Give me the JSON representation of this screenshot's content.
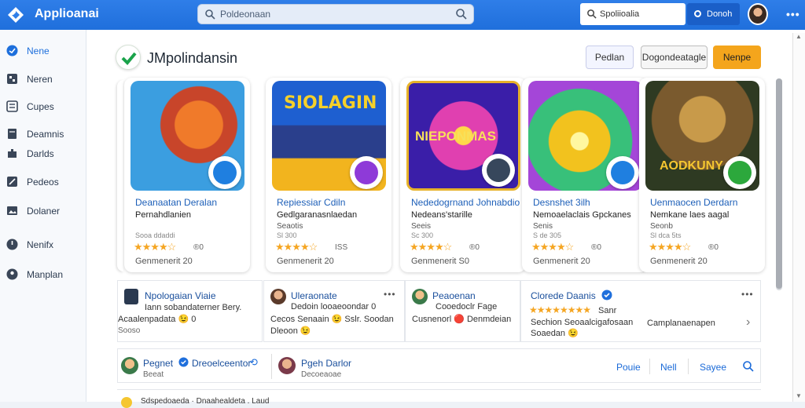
{
  "topbar": {
    "title": "Applioanai",
    "search_placeholder": "Poldeonaan",
    "search2_placeholder": "Spoliioalia",
    "button_label": "Donoh",
    "more": "•••"
  },
  "sidebar": {
    "items": [
      {
        "label": "Nene",
        "icon": "info-icon"
      },
      {
        "label": "Neren",
        "icon": "grid-icon"
      },
      {
        "label": "Cupes",
        "icon": "list-icon"
      },
      {
        "label": "Deamnis",
        "icon": "document-icon"
      },
      {
        "label": "Darlds",
        "icon": "puzzle-icon"
      },
      {
        "label": "Pedeos",
        "icon": "edit-icon"
      },
      {
        "label": "Dolaner",
        "icon": "image-icon"
      },
      {
        "label": "Nenifx",
        "icon": "power-icon"
      },
      {
        "label": "Manplan",
        "icon": "person-icon"
      }
    ]
  },
  "header": {
    "title": "JMpolindansin",
    "btn1": "Pedlan",
    "btn2": "Dogondeatagle",
    "btn3": "Nenpe"
  },
  "cards": [
    {
      "t1": "Deanaatan Deralan",
      "t2": "Pernahdlanien",
      "t3": "",
      "t4": "Sooa ddaddi",
      "stars": "★★★★☆",
      "rating": "®0",
      "t5": "Genmenerit 20",
      "c1": "#3b9ee0",
      "c2": "#f07a2a",
      "badge": "#1f7fe0"
    },
    {
      "t1": "Repiessiar Cdiln",
      "t2": "Gedlgaranasnlaedan",
      "t3": "Seaotis",
      "t4": "Sl 300",
      "stars": "★★★★☆",
      "rating": "ISS",
      "t5": "Genmenerit 20",
      "c1": "#2160d0",
      "c2": "#f2b41e",
      "badge": "#8e3ad8"
    },
    {
      "t1": "Nededogrnand Johnabdio",
      "t2": "Nedeans'starille",
      "t3": "Seeis",
      "t4": "Sc 300",
      "stars": "★★★★☆",
      "rating": "®0",
      "t5": "Genmenerit S0",
      "c1": "#e040b0",
      "c2": "#3a1ea8",
      "badge": "#37475c"
    },
    {
      "t1": "Desnshet 3ilh",
      "t2": "Nemoaelaclais Gpckanes",
      "t3": "Senis",
      "t4": "S de 305",
      "stars": "★★★★☆",
      "rating": "®0",
      "t5": "Genmenerit 20",
      "c1": "#f2c21e",
      "c2": "#38c07a",
      "badge": "#1f7fe0"
    },
    {
      "t1": "Uenmaocen Derdarn",
      "t2": "Nemkane laes aagal",
      "t3": "Seonb",
      "t4": "Sl dca 5ts",
      "stars": "★★★★☆",
      "rating": "®0",
      "t5": "Genmenerit 20",
      "c1": "#7a5a2e",
      "c2": "#c89a4a",
      "badge": "#2ca83c"
    }
  ],
  "posts": [
    {
      "name": "Npologaian Viaie",
      "l1": "Iann sobandaterner Bery.",
      "l2": "Acaalenpadata 😉 0",
      "l3": "Sooso"
    },
    {
      "name": "Uleraonate",
      "l1": "Dedoin looaeoondar 0",
      "l2": "Cecos Senaain 😉 Sslr. Soodan",
      "l3": "Dleoon 😉"
    },
    {
      "name": "Peaoenan",
      "l1": "Cooedoclr Fage",
      "l2": "Cusnenorl 🔴 Denmdeian",
      "l3": ""
    },
    {
      "name": "Clorede Daanis",
      "l1": "Sanr",
      "l2": "Sechion Seoaalcigafosaan",
      "l3": "Soaedan 😉",
      "side": "Camplanaenapen"
    }
  ],
  "bottom": {
    "user1": "Pegnet",
    "user1_extra": "Dreoelceentor",
    "user1_sub": "Beeat",
    "user2": "Pgeh Darlor",
    "user2_sub": "Decoeaoae",
    "link1": "Pouie",
    "link2": "Nell",
    "link3": "Sayee",
    "footer_text": "Sdspedoaeda · Dnaahealdeta . Laud"
  },
  "colors": {
    "accent": "#1f6fdc",
    "orange": "#f4a51c",
    "star": "#f5a623"
  }
}
